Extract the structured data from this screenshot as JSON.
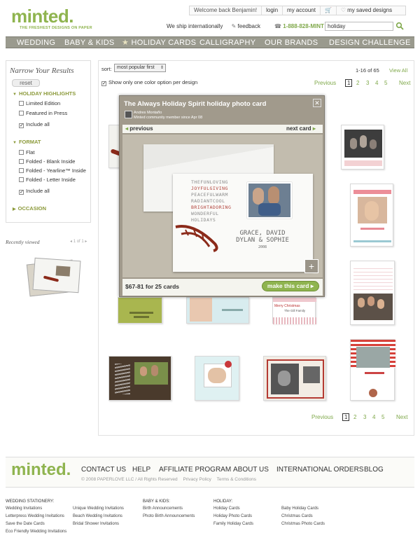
{
  "header": {
    "logo": "minted.",
    "tagline": "THE FRESHEST DESIGNS ON PAPER",
    "welcome": "Welcome back Benjamin!",
    "login": "login",
    "my_account": "my account",
    "saved": "my saved designs",
    "ship": "We ship internationally",
    "feedback": "feedback",
    "phone": "1-888-828-MINT",
    "search_value": "holiday"
  },
  "nav": [
    "WEDDING",
    "BABY & KIDS",
    "HOLIDAY CARDS",
    "CALLIGRAPHY",
    "OUR BRANDS",
    "DESIGN CHALLENGE"
  ],
  "sidebar": {
    "heading": "Narrow Your Results",
    "reset": "reset",
    "sections": [
      {
        "title": "HOLIDAY HIGHLIGHTS",
        "options": [
          {
            "label": "Limited Edition",
            "checked": false
          },
          {
            "label": "Featured in Press",
            "checked": false
          },
          {
            "label": "Include all",
            "checked": true
          }
        ]
      },
      {
        "title": "FORMAT",
        "options": [
          {
            "label": "Flat",
            "checked": false
          },
          {
            "label": "Folded - Blank Inside",
            "checked": false
          },
          {
            "label": "Folded - Yearline™ Inside",
            "checked": false
          },
          {
            "label": "Folded - Letter Inside",
            "checked": false
          },
          {
            "label": "Include all",
            "checked": true
          }
        ]
      },
      {
        "title": "OCCASION",
        "options": []
      }
    ],
    "recent_label": "Recently viewed",
    "recent_pager": "1 of 1"
  },
  "results": {
    "sort_label": "sort:",
    "sort_value": "most popular first",
    "show_one": "Show only one color option per design",
    "count": "1-16 of 65",
    "view_all": "View All",
    "pager": {
      "prev": "Previous",
      "pages": [
        "1",
        "2",
        "3",
        "4",
        "5"
      ],
      "current": "1",
      "next": "Next"
    }
  },
  "modal": {
    "title": "The Always Holiday Spirit holiday photo card",
    "author": "Andres Montaño",
    "member_since": "Minted community member since Apr 08",
    "previous": "previous",
    "next": "next card",
    "card_lines": [
      "THEFUNLOVING",
      "JOYFULGIVING",
      "PEACEFULWARM",
      "RADIANTCOOL",
      "BRIGHTADORING",
      "WONDERFUL",
      "HOLIDAYS"
    ],
    "card_names": [
      "GRACE, DAVID",
      "DYLAN & SOPHIE"
    ],
    "card_year": "2008",
    "price": "$67-81 for 25 cards",
    "button": "make this card"
  },
  "tile_texts": {
    "merry": "Merry Christmas",
    "family": "The Gill Family"
  },
  "footer": {
    "logo": "minted.",
    "links": [
      "CONTACT US",
      "HELP",
      "AFFILIATE PROGRAM",
      "ABOUT US",
      "INTERNATIONAL ORDERS",
      "BLOG"
    ],
    "copyright": "© 2008 PAPERLOVE LLC / All Rights Reserved",
    "privacy": "Privacy Policy",
    "terms": "Terms & Conditions",
    "groups": [
      {
        "heading": "WEDDING STATIONERY:",
        "items": [
          "Wedding Invitations",
          "Letterpress Wedding Invitations",
          "Save the Date Cards",
          "Eco Friendly Wedding Invitations"
        ]
      },
      {
        "heading": "",
        "items": [
          "Unique Wedding Invitations",
          "Beach Wedding Invitations",
          "Bridal Shower Invitations"
        ]
      },
      {
        "heading": "BABY & KIDS:",
        "items": [
          "Birth Announcements",
          "Photo Birth Announcements"
        ]
      },
      {
        "heading": "HOLIDAY:",
        "items": [
          "Holiday Cards",
          "Holiday Photo Cards",
          "Family Holiday Cards"
        ]
      },
      {
        "heading": "",
        "items": [
          "Baby Holiday Cards",
          "Christmas Cards",
          "Christmas Photo Cards"
        ]
      }
    ]
  }
}
